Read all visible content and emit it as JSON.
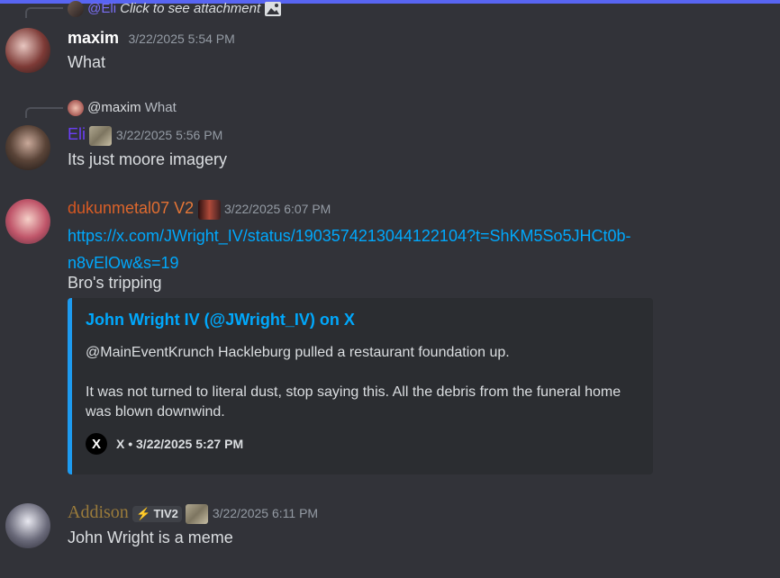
{
  "colors": {
    "accent": "#5865f2",
    "eli": "#6b3ff7",
    "dukun_start": "#d7551f",
    "dukun_end": "#e87a39",
    "addison": "#9a7b3b",
    "embed_border": "#1d9bf0",
    "link": "#00a8fc"
  },
  "reply_top": {
    "mention": "@Eli",
    "text": "Click to see attachment",
    "icon": "image-icon"
  },
  "messages": [
    {
      "username": "maxim",
      "timestamp": "3/22/2025 5:54 PM",
      "text": "What"
    },
    {
      "reply_mention": "@maxim",
      "reply_text": "What",
      "username": "Eli",
      "timestamp": "3/22/2025 5:56 PM",
      "text": "Its just moore imagery"
    },
    {
      "username": "dukunmetal07 V2",
      "timestamp": "3/22/2025 6:07 PM",
      "link_line1": "https://x.com/JWright_IV/status/1903574213044122104?t=ShKM5So5JHCt0b-",
      "link_line2": "n8vElOw&s=19",
      "text": "Bro's tripping",
      "embed": {
        "title": "John Wright IV (@JWright_IV) on X",
        "desc1": "@MainEventKrunch Hackleburg pulled a restaurant foundation up.",
        "desc2": "It was not turned to literal dust, stop saying this. All the debris from the funeral home was blown downwind.",
        "footer": "X • 3/22/2025 5:27 PM",
        "footer_logo": "X"
      }
    },
    {
      "username": "Addison",
      "tag": "TIV2",
      "tag_icon": "lightning-icon",
      "timestamp": "3/22/2025 6:11 PM",
      "text": "John Wright is a meme"
    }
  ]
}
